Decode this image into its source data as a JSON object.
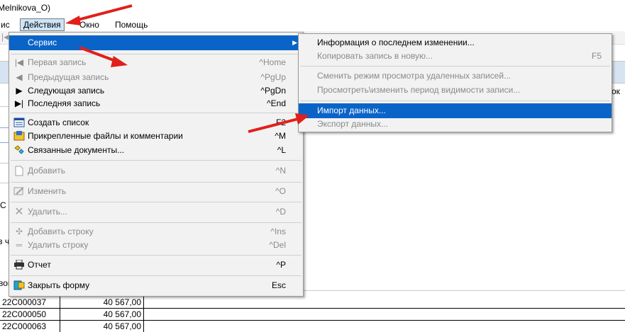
{
  "window": {
    "title_fragment": "Melnikova_O)"
  },
  "menubar": {
    "items": [
      {
        "label": "ис"
      },
      {
        "label": "Действия"
      },
      {
        "label": "Окно"
      },
      {
        "label": "Помощь"
      }
    ]
  },
  "background": {
    "left_frag_1": "С",
    "left_frag_2": "з ч",
    "left_frag_3": "вой",
    "right_frag": "ок"
  },
  "grid": {
    "rows": [
      {
        "code": "22C000037",
        "amount": "40 567,00"
      },
      {
        "code": "22C000050",
        "amount": "40 567,00"
      },
      {
        "code": "22C000063",
        "amount": "40 567,00"
      }
    ]
  },
  "actions_menu": {
    "service": {
      "label": "Сервис"
    },
    "items": [
      {
        "label": "Первая запись",
        "shortcut": "^Home",
        "icon": "first-record-icon",
        "disabled": true
      },
      {
        "label": "Предыдущая запись",
        "shortcut": "^PgUp",
        "icon": "previous-record-icon",
        "disabled": true
      },
      {
        "label": "Следующая запись",
        "shortcut": "^PgDn",
        "icon": "next-record-icon",
        "disabled": false
      },
      {
        "label": "Последняя запись",
        "shortcut": "^End",
        "icon": "last-record-icon",
        "disabled": false
      },
      {
        "label": "Создать список",
        "shortcut": "F2",
        "icon": "create-list-icon",
        "disabled": false
      },
      {
        "label": "Прикрепленные файлы и комментарии",
        "shortcut": "^M",
        "icon": "attachments-icon",
        "disabled": false
      },
      {
        "label": "Связанные документы...",
        "shortcut": "^L",
        "icon": "linked-documents-icon",
        "disabled": false
      },
      {
        "label": "Добавить",
        "shortcut": "^N",
        "icon": "add-icon",
        "disabled": true
      },
      {
        "label": "Изменить",
        "shortcut": "^O",
        "icon": "edit-icon",
        "disabled": true
      },
      {
        "label": "Удалить...",
        "shortcut": "^D",
        "icon": "delete-icon",
        "disabled": true
      },
      {
        "label": "Добавить строку",
        "shortcut": "^Ins",
        "icon": "add-row-icon",
        "disabled": true
      },
      {
        "label": "Удалить строку",
        "shortcut": "^Del",
        "icon": "delete-row-icon",
        "disabled": true
      },
      {
        "label": "Отчет",
        "shortcut": "^P",
        "icon": "printer-icon",
        "disabled": false
      },
      {
        "label": "Закрыть форму",
        "shortcut": "Esc",
        "icon": "close-form-icon",
        "disabled": false
      }
    ]
  },
  "service_submenu": {
    "items": [
      {
        "label": "Информация о последнем изменении...",
        "shortcut": "",
        "disabled": false
      },
      {
        "label": "Копировать запись в новую...",
        "shortcut": "F5",
        "disabled": true
      },
      {
        "label": "Сменить режим просмотра удаленных записей...",
        "shortcut": "",
        "disabled": true
      },
      {
        "label": "Просмотреть\\изменить период видимости записи...",
        "shortcut": "",
        "disabled": true
      },
      {
        "label": "Импорт данных...",
        "shortcut": "",
        "disabled": false,
        "highlighted": true
      },
      {
        "label": "Экспорт данных...",
        "shortcut": "",
        "disabled": true
      }
    ]
  },
  "colors": {
    "highlight": "#0a64c8",
    "annotation_arrow": "#e0201a"
  }
}
